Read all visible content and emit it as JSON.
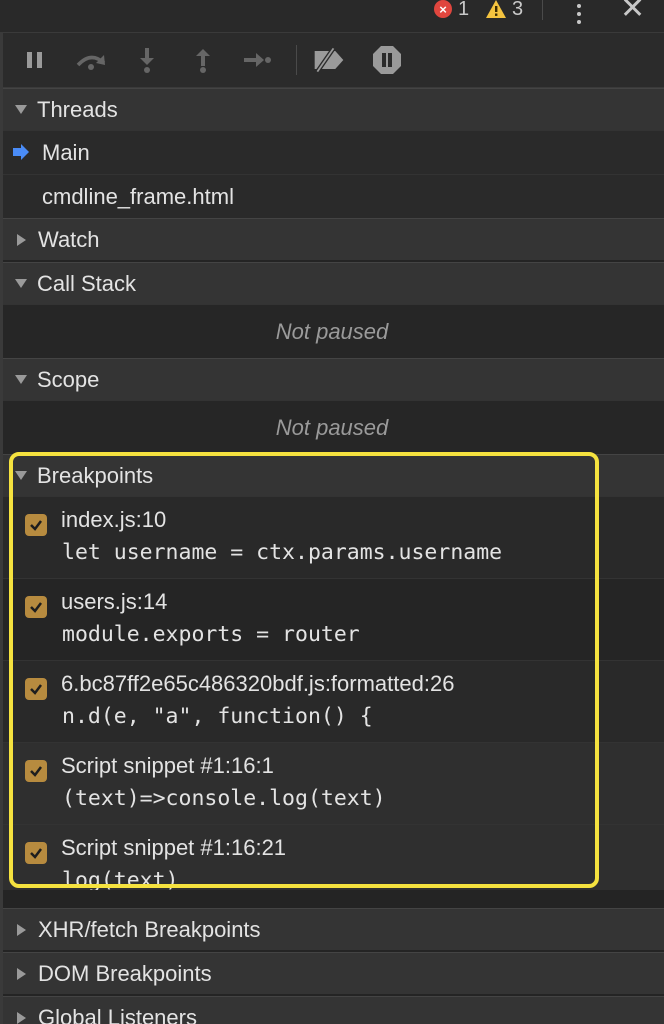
{
  "status": {
    "error_count": "1",
    "warning_count": "3",
    "error_color": "#e0463e",
    "warning_color": "#f4c33f"
  },
  "toolbar": {
    "buttons": [
      "pause-icon",
      "step-over-icon",
      "step-into-icon",
      "step-out-icon",
      "step-icon",
      "deactivate-breakpoints-icon",
      "pause-on-exceptions-icon"
    ]
  },
  "sections": {
    "threads": {
      "title": "Threads",
      "items": [
        {
          "label": "Main",
          "active": true
        },
        {
          "label": "cmdline_frame.html",
          "active": false
        }
      ]
    },
    "watch": {
      "title": "Watch"
    },
    "call_stack": {
      "title": "Call Stack",
      "empty_text": "Not paused"
    },
    "scope": {
      "title": "Scope",
      "empty_text": "Not paused"
    },
    "breakpoints": {
      "title": "Breakpoints",
      "items": [
        {
          "location": "index.js:10",
          "code": "let username = ctx.params.username",
          "checked": true
        },
        {
          "location": "users.js:14",
          "code": "module.exports = router",
          "checked": true
        },
        {
          "location": "6.bc87ff2e65c486320bdf.js:formatted:26",
          "code": "n.d(e, \"a\", function() {",
          "checked": true
        },
        {
          "location": "Script snippet #1:16:1",
          "code": "(text)=>console.log(text)",
          "checked": true
        },
        {
          "location": "Script snippet #1:16:21",
          "code": "log(text)",
          "checked": true
        }
      ]
    },
    "xhr": {
      "title": "XHR/fetch Breakpoints"
    },
    "dom": {
      "title": "DOM Breakpoints"
    },
    "global": {
      "title": "Global Listeners"
    }
  },
  "colors": {
    "highlight": "#f5e23f",
    "checkbox": "#b78b3f",
    "thread_arrow": "#4a8cf7"
  }
}
